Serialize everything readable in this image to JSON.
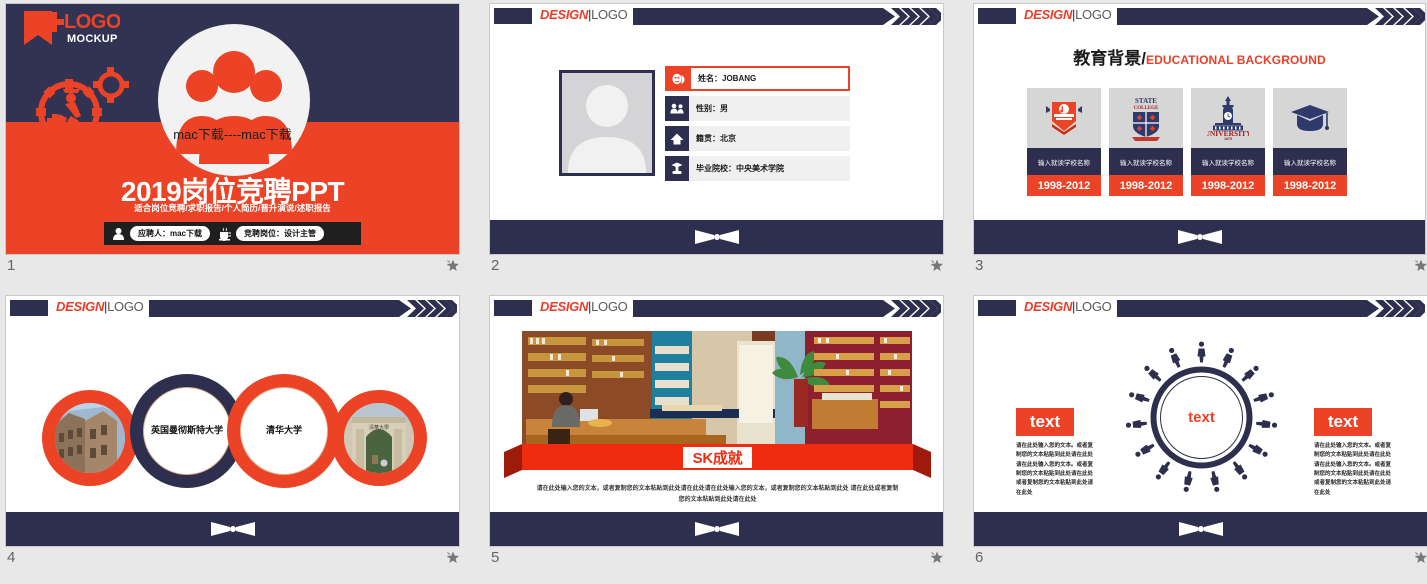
{
  "deck": {
    "header": {
      "design": "DESIGN",
      "divider": "|",
      "logo": "LOGO"
    },
    "colors": {
      "navy": "#2e2e4f",
      "red": "#ec4326",
      "light_gray": "#e8e8e8",
      "card_gray": "#d6d6d6"
    }
  },
  "slides": [
    {
      "number": "1",
      "logo_main": "LOGO",
      "logo_sub": "MOCKUP",
      "watermark": "mac下载----mac下载",
      "title": "2019岗位竞聘PPT",
      "subtitle": "适合岗位竞聘/求职报告/个人简历/晋升演说/述职报告",
      "applicant_label": "应聘人：mac下载",
      "position_label": "竞聘岗位：设计主管"
    },
    {
      "number": "2",
      "fields": [
        {
          "icon": "masks-icon",
          "label": "姓名：JOBANG",
          "active": true
        },
        {
          "icon": "people-icon",
          "label": "性别：男",
          "active": false
        },
        {
          "icon": "home-icon",
          "label": "籍贯：北京",
          "active": false
        },
        {
          "icon": "graduate-icon",
          "label": "毕业院校：中央美术学院",
          "active": false
        }
      ]
    },
    {
      "number": "3",
      "title_cn": "教育背景/",
      "title_en": "EDUCATIONAL BACKGROUND",
      "cards": [
        {
          "icon": "college-of-music-badge-icon",
          "name": "输入就读学校名称",
          "years": "1998-2012"
        },
        {
          "icon": "state-college-crest-icon",
          "name": "输入就读学校名称",
          "years": "1998-2012"
        },
        {
          "icon": "university-tower-icon",
          "name": "输入就读学校名称",
          "years": "1998-2012"
        },
        {
          "icon": "graduation-cap-icon",
          "name": "输入就读学校名称",
          "years": "1998-2012"
        }
      ]
    },
    {
      "number": "4",
      "circles": [
        {
          "kind": "image",
          "ring": "red",
          "caption": ""
        },
        {
          "kind": "text",
          "ring": "navy",
          "caption": "英国曼彻\n斯特大学"
        },
        {
          "kind": "text",
          "ring": "red",
          "caption": "清华\n大学"
        },
        {
          "kind": "image",
          "ring": "red",
          "caption": ""
        }
      ],
      "circle_texts": [
        "英国曼彻斯特大学",
        "清华大学"
      ]
    },
    {
      "number": "5",
      "ribbon_title": "SK成就",
      "caption_line1": "请在此处输入您的文本，或者复制您的文本粘贴到此处请在此处请在此处输入您的文本，或者复制您的文本粘贴到此处",
      "caption_line2": "请在此处或者复制您的文本粘贴到此处请在此处"
    },
    {
      "number": "6",
      "center_text": "text",
      "left_badge": "text",
      "right_badge": "text",
      "left_text": "请在此处输入您的文本。或者复制您的文本粘贴到此处请在此处请在此处输入您的文本。或者复制您的文本粘贴到此处请在此处或者复制您的文本粘贴到此处请在此处",
      "right_text": "请在此处输入您的文本。或者复制您的文本粘贴到此处请在此处请在此处输入您的文本。或者复制您的文本粘贴到此处请在此处或者复制您的文本粘贴到此处请在此处"
    }
  ]
}
